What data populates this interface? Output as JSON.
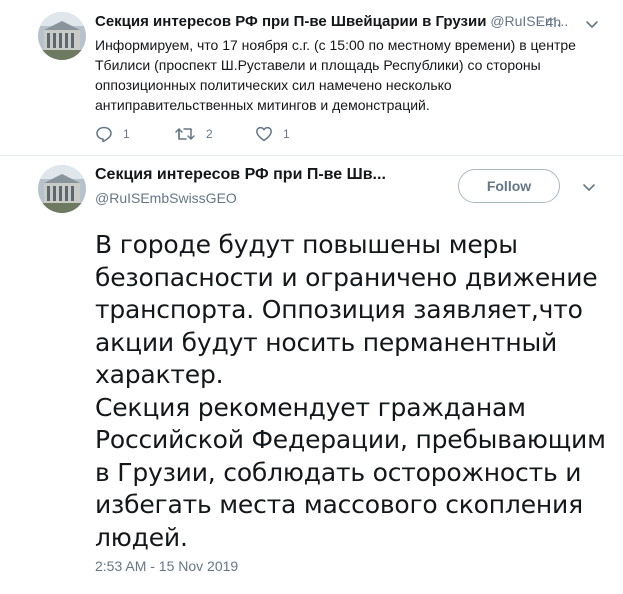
{
  "tweet1": {
    "author_name": "Секция интересов РФ при П-ве Швейцарии в Грузии",
    "author_handle": "@RuISEm...",
    "time": "· 4h",
    "text": "Информируем, что 17 ноября с.г. (с 15:00 по местному времени) в центре Тбилиси (проспект Ш.Руставели и площадь Республики) со стороны оппозиционных политических сил намечено несколько антиправительственных митингов и демонстраций.",
    "reply_count": "1",
    "retweet_count": "2",
    "like_count": "1"
  },
  "tweet2": {
    "author_name": "Секция интересов РФ при П-ве Шв...",
    "author_handle": "@RuISEmbSwissGEO",
    "follow_label": "Follow",
    "body_lines": [
      "В городе будут повышены меры",
      "безопасности и ограничено движение",
      "транспорта. Оппозиция заявляет,что",
      "акции будут носить перманентный",
      "характер.",
      "Секция рекомендует гражданам",
      "Российской Федерации, пребывающим",
      "в Грузии, соблюдать осторожность и",
      "избегать места массового скопления",
      "людей."
    ],
    "timestamp": "2:53 AM - 15 Nov 2019"
  },
  "colors": {
    "text": "#14171a",
    "muted": "#657786",
    "divider": "#e6ecf0",
    "follow_border": "#aab8c2"
  },
  "icons": [
    "reply-icon",
    "retweet-icon",
    "like-icon",
    "chevron-down-icon",
    "avatar-building-photo"
  ]
}
